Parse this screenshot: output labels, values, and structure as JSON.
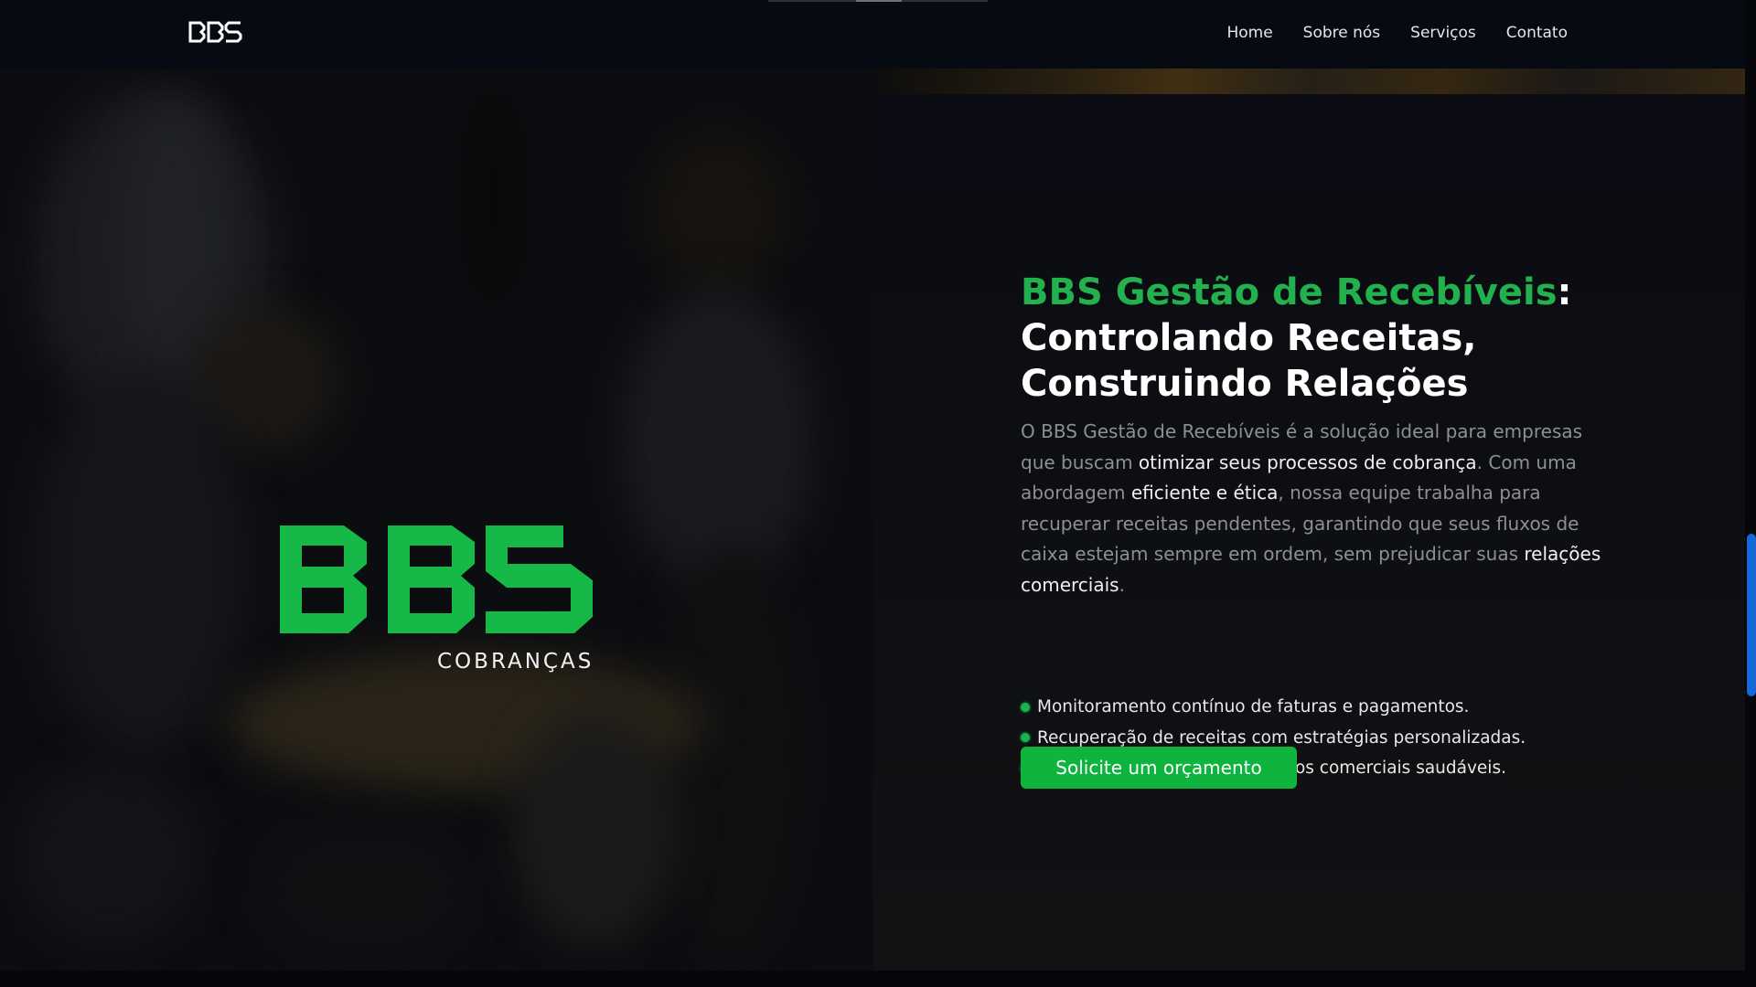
{
  "nav": {
    "logo_text": "BBS",
    "links": [
      "Home",
      "Sobre nós",
      "Serviços",
      "Contato"
    ]
  },
  "hero": {
    "logo_text": "BBS",
    "logo_subtitle": "COBRANÇAS"
  },
  "content": {
    "headline_accent": "BBS Gestão de Recebíveis",
    "headline_colon": ":",
    "headline_line2": "Controlando Receitas,",
    "headline_line3": "Construindo Relações",
    "intro": {
      "p1": "O BBS Gestão de Recebíveis é a solução ideal para empresas que buscam ",
      "hl1": "otimizar seus processos de cobrança",
      "p2": ". Com uma abordagem ",
      "hl2": "eficiente e ética",
      "p3": ", nossa equipe trabalha para recuperar receitas pendentes, garantindo que seus fluxos de caixa estejam sempre em ordem, sem prejudicar suas ",
      "hl3": "relações comerciais",
      "p4": "."
    },
    "features": [
      "Monitoramento contínuo de faturas e pagamentos.",
      "Recuperação de receitas com estratégias personalizadas.",
      "Manutenção de relacionamentos comerciais saudáveis."
    ],
    "cta_label": "Solicite um orçamento"
  },
  "colors": {
    "brand_green": "#22b14c",
    "button_green": "#0fb43e",
    "background": "#05070c",
    "scrollbar": "#1668d6"
  }
}
